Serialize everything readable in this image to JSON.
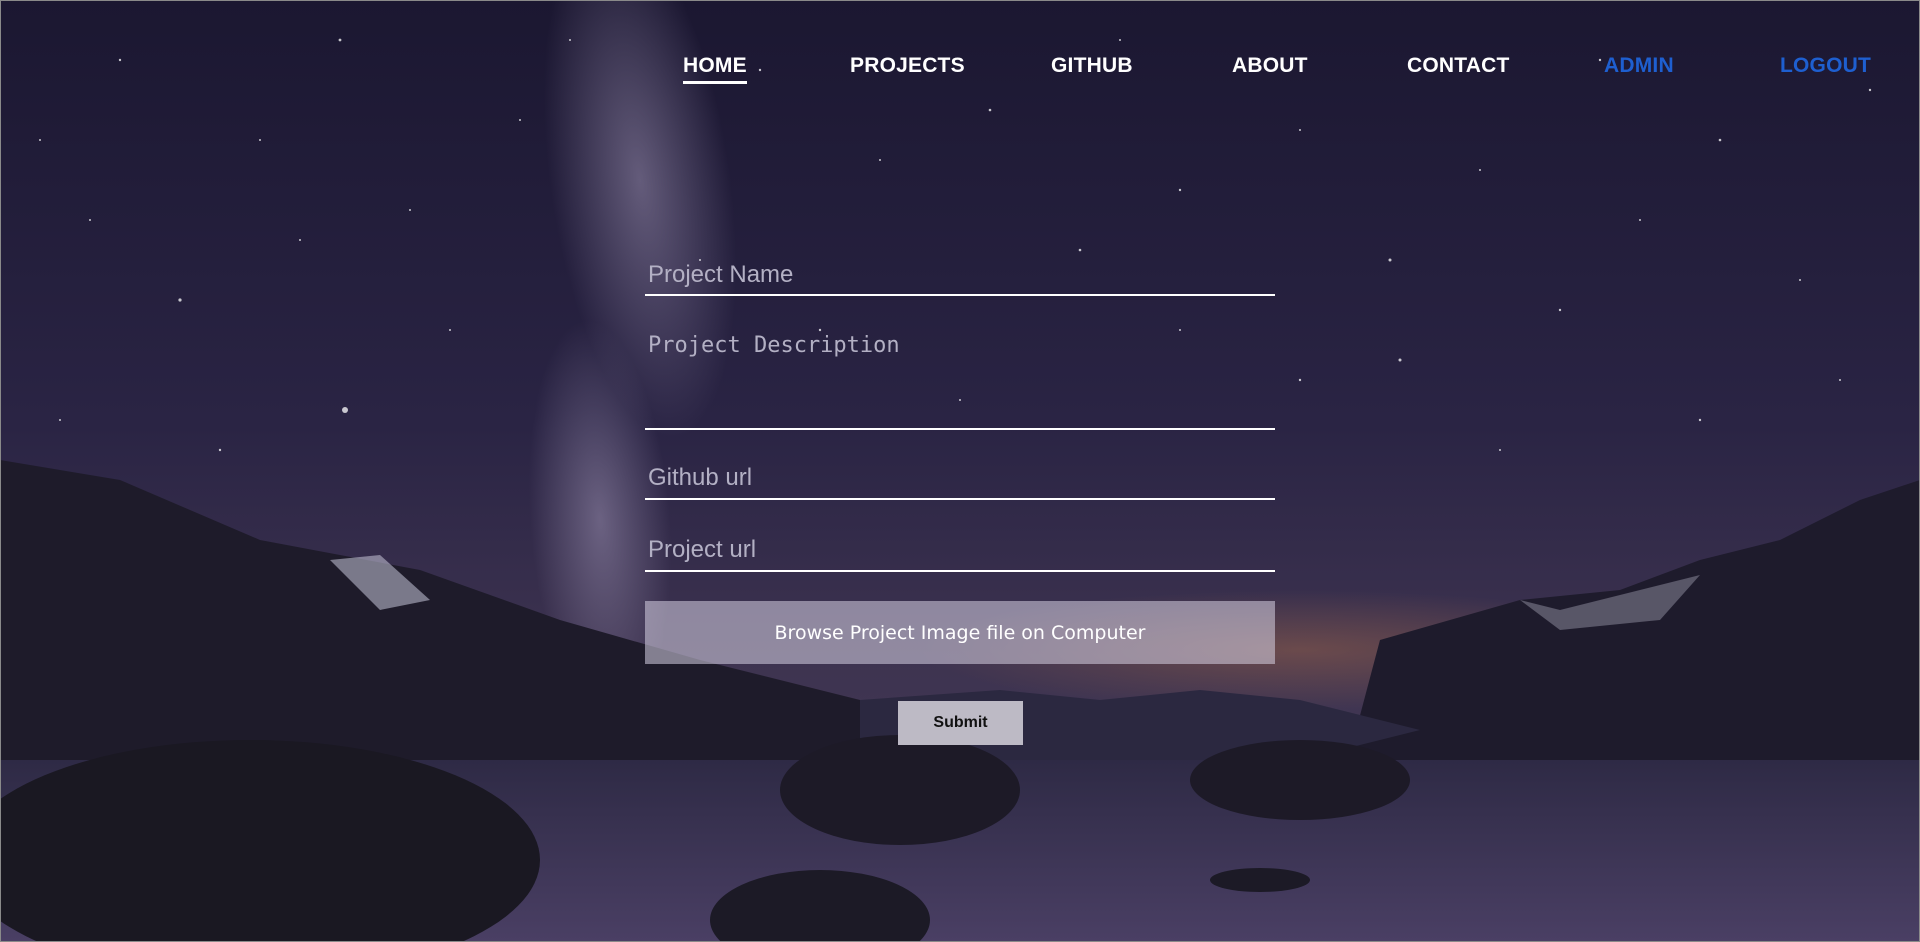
{
  "nav": {
    "items": [
      {
        "label": "HOME",
        "active": true
      },
      {
        "label": "PROJECTS"
      },
      {
        "label": "GITHUB"
      },
      {
        "label": "ABOUT"
      },
      {
        "label": "CONTACT"
      },
      {
        "label": "ADMIN"
      },
      {
        "label": "LOGOUT"
      }
    ],
    "accent_color": "#1e5fd0"
  },
  "form": {
    "project_name_placeholder": "Project Name",
    "project_description_placeholder": "Project Description",
    "github_url_placeholder": "Github url",
    "project_url_placeholder": "Project url",
    "browse_label": "Browse Project Image file on Computer",
    "submit_label": "Submit"
  },
  "background": {
    "sky_color": "#221d3a",
    "mountain_color": "#1c1a28",
    "water_color": "#3c3458"
  }
}
